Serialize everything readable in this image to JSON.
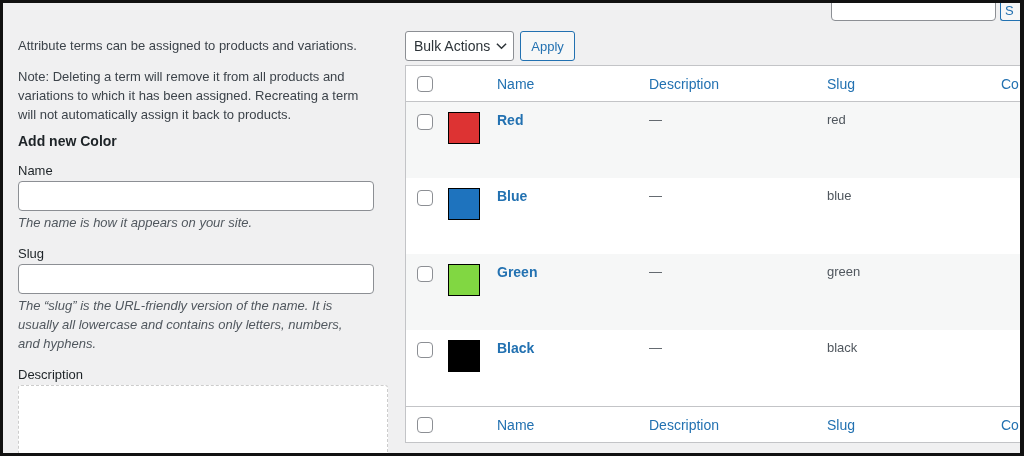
{
  "form": {
    "intro": "Attribute terms can be assigned to products and variations.",
    "note": "Note: Deleting a term will remove it from all products and variations to which it has been assigned. Recreating a term will not automatically assign it back to products.",
    "heading": "Add new Color",
    "fields": [
      {
        "kind": "input",
        "label": "Name",
        "hint": "The name is how it appears on your site."
      },
      {
        "kind": "input",
        "label": "Slug",
        "hint": "The “slug” is the URL-friendly version of the name. It is usually all lowercase and contains only letters, numbers, and hyphens."
      },
      {
        "kind": "textarea",
        "label": "Description"
      }
    ]
  },
  "search": {
    "button": "S"
  },
  "bulk_actions": {
    "select": "Bulk Actions",
    "apply": "Apply"
  },
  "table": {
    "header_checked": false,
    "footer_checked": false,
    "columns": [
      "Name",
      "Description",
      "Slug",
      "Co"
    ],
    "rows": [
      {
        "checked": false,
        "color": "#dd3333",
        "name": "Red",
        "description": "—",
        "slug": "red"
      },
      {
        "checked": false,
        "color": "#1e73be",
        "name": "Blue",
        "description": "—",
        "slug": "blue"
      },
      {
        "checked": false,
        "color": "#81d742",
        "name": "Green",
        "description": "—",
        "slug": "green"
      },
      {
        "checked": false,
        "color": "#000000",
        "name": "Black",
        "description": "—",
        "slug": "black"
      }
    ],
    "footer_columns": [
      "Name",
      "Description",
      "Slug",
      "Co"
    ]
  }
}
